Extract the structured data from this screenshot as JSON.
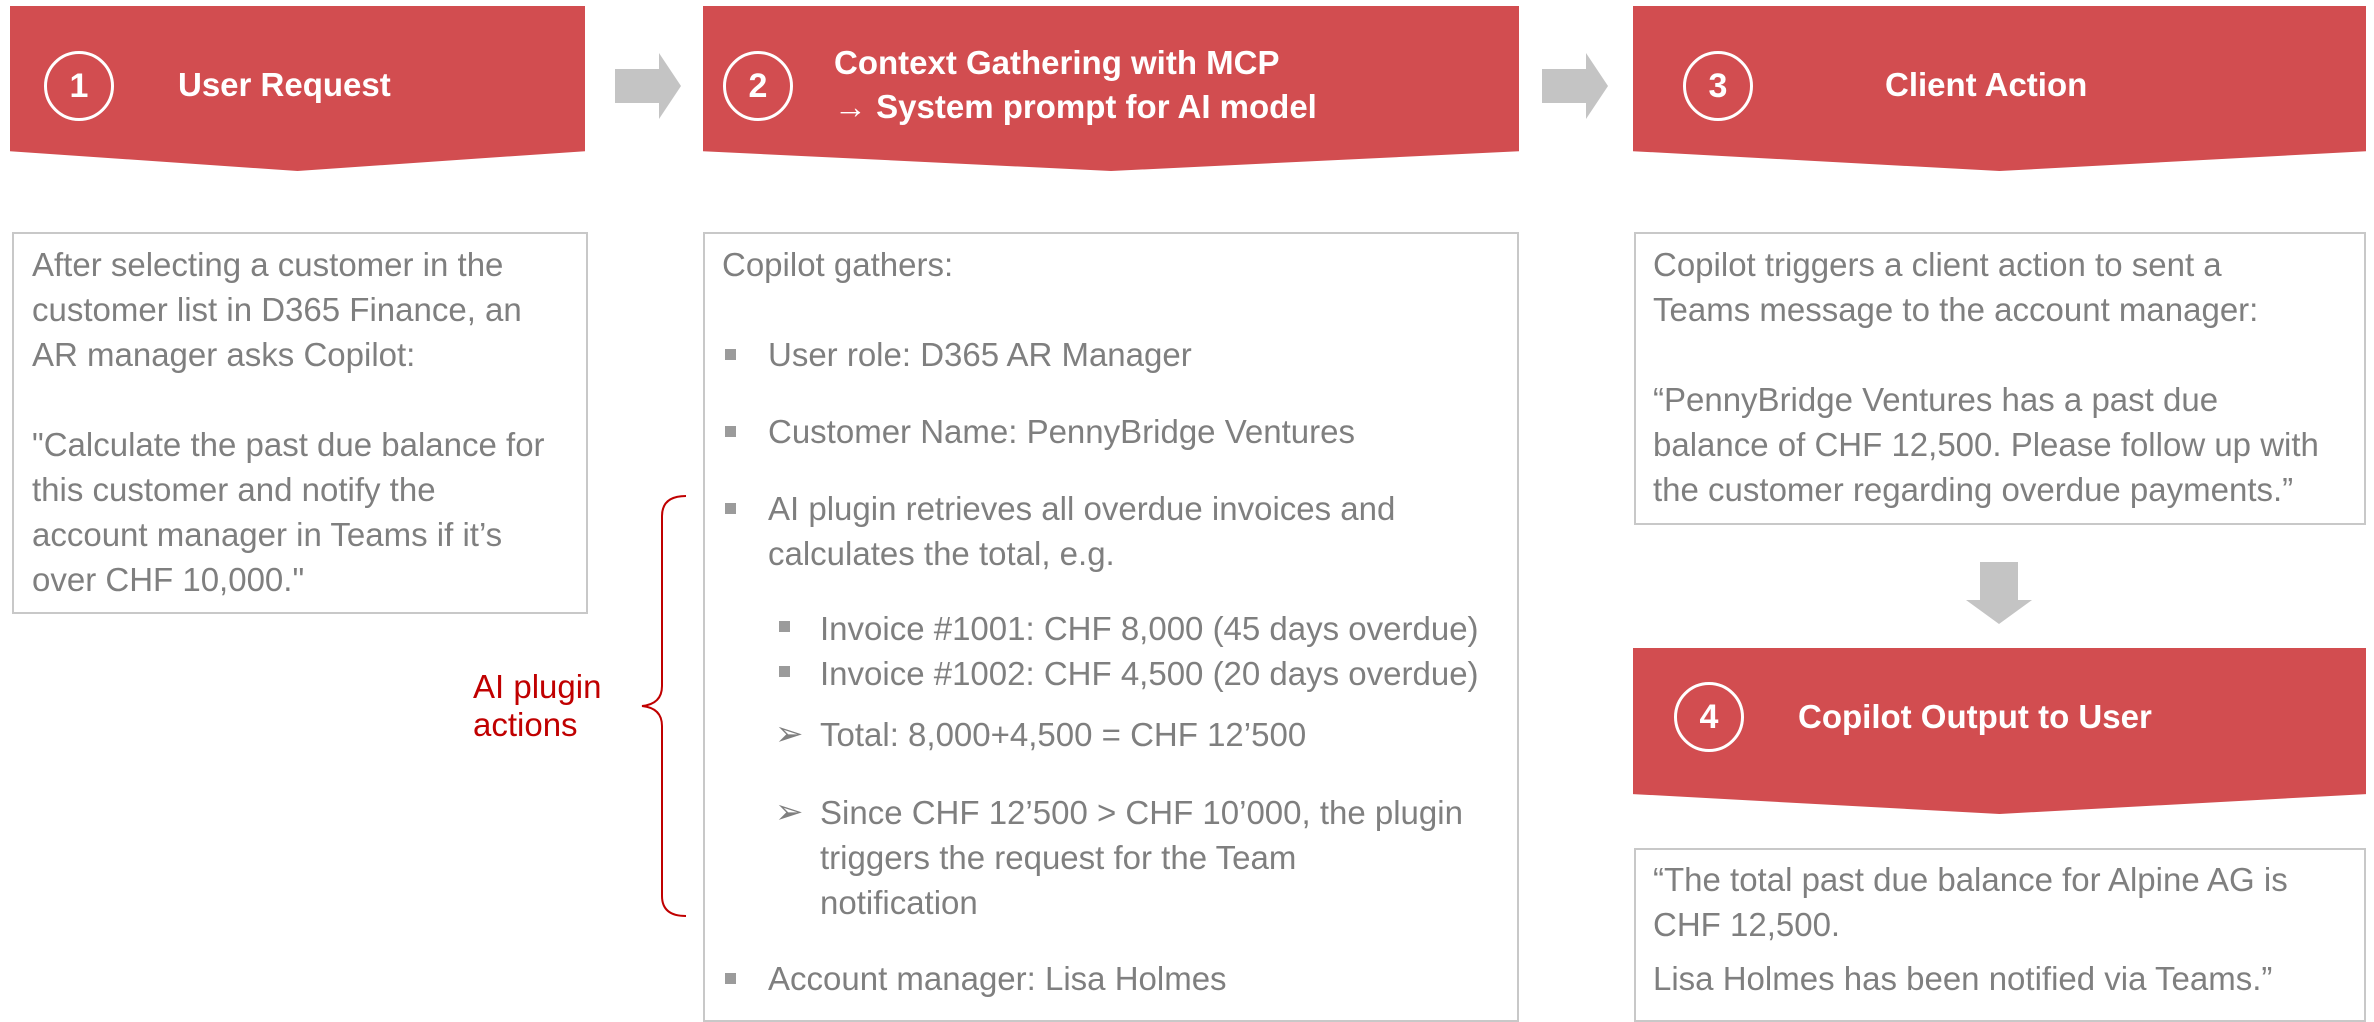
{
  "colors": {
    "banner": "#d24d50",
    "box_border": "#c8c8c8",
    "text": "#7f7f7f",
    "accent_label": "#c00000",
    "arrow": "#c4c4c4"
  },
  "step1": {
    "number": "1",
    "title": "User Request",
    "lines": [
      "After selecting a customer in the",
      "customer list in D365 Finance, an",
      "AR manager asks Copilot:",
      "\"Calculate the past due balance for",
      "this customer and notify the",
      "account manager in Teams if it’s",
      "over CHF 10,000.\""
    ]
  },
  "step2": {
    "number": "2",
    "title_line1": "Context Gathering with MCP",
    "title_line2": "→ System prompt for AI model",
    "intro": "Copilot gathers:",
    "bullets": [
      "User role: D365 AR Manager",
      "Customer Name: PennyBridge Ventures",
      "AI plugin retrieves all overdue invoices and",
      "calculates the total, e.g."
    ],
    "sub_bullets": [
      "Invoice #1001: CHF 8,000 (45 days overdue)",
      "Invoice #1002: CHF 4,500 (20 days overdue)"
    ],
    "arrows": [
      "Total: 8,000+4,500 = CHF 12’500",
      "Since CHF 12’500 > CHF 10’000, the plugin",
      "triggers the request for the Team",
      "notification"
    ],
    "last_bullet": "Account manager: Lisa Holmes"
  },
  "side_label": {
    "line1": "AI plugin",
    "line2": "actions"
  },
  "step3": {
    "number": "3",
    "title": "Client Action",
    "lines": [
      "Copilot triggers a client action to sent a",
      "Teams message to the account manager:",
      "“PennyBridge Ventures has a past due",
      "balance of CHF 12,500. Please follow up with",
      "the customer regarding overdue payments.”"
    ]
  },
  "step4": {
    "number": "4",
    "title": "Copilot Output to User",
    "lines": [
      "“The total past due balance for Alpine AG is",
      "CHF 12,500.",
      "Lisa Holmes has been notified via Teams.”"
    ]
  }
}
